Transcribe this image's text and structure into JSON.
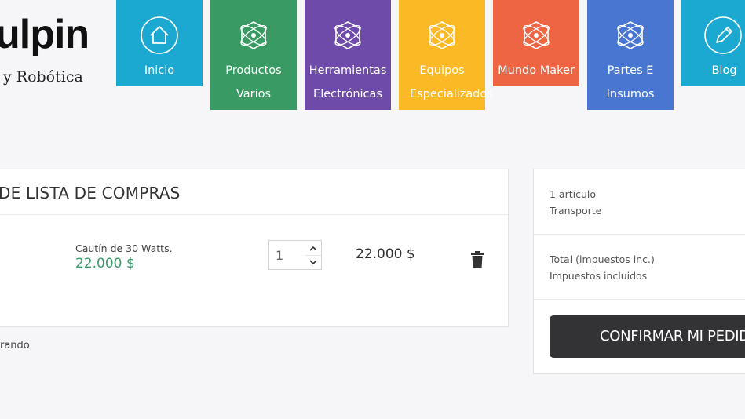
{
  "logo": {
    "main": "ulpin",
    "sub": "y Robótica"
  },
  "nav": [
    {
      "label": "Inicio",
      "color": "#1ba8d1",
      "icon": "home-icon"
    },
    {
      "label": "Productos Varios",
      "color": "#3a9a63",
      "icon": "atom-hex-icon"
    },
    {
      "label": "Herramientas Electrónicas",
      "color": "#6e4ba8",
      "icon": "atom-hex-icon"
    },
    {
      "label": "Equipos Especializados",
      "color": "#fbb925",
      "icon": "atom-hex-icon"
    },
    {
      "label": "Mundo Maker",
      "color": "#ee6544",
      "icon": "atom-hex-icon"
    },
    {
      "label": "Partes E Insumos",
      "color": "#4876d1",
      "icon": "atom-hex-icon"
    },
    {
      "label": "Blog",
      "color": "#1ba8d1",
      "icon": "pencil-icon"
    }
  ],
  "cart": {
    "title": "DE LISTA DE COMPRAS",
    "item": {
      "name": "Cautín de 30 Watts.",
      "price": "22.000 $",
      "quantity": "1",
      "total": "22.000 $"
    },
    "continue_text": "rando"
  },
  "summary": {
    "articles": "1 artículo",
    "shipping": "Transporte",
    "total_label": "Total (impuestos inc.)",
    "taxes_label": "Impuestos incluidos",
    "confirm_label": "CONFIRMAR MI PEDIDO"
  },
  "colors": {
    "price_green": "#3a9a6a",
    "confirm_bg": "#333235",
    "page_bg": "#f6f5f8"
  }
}
